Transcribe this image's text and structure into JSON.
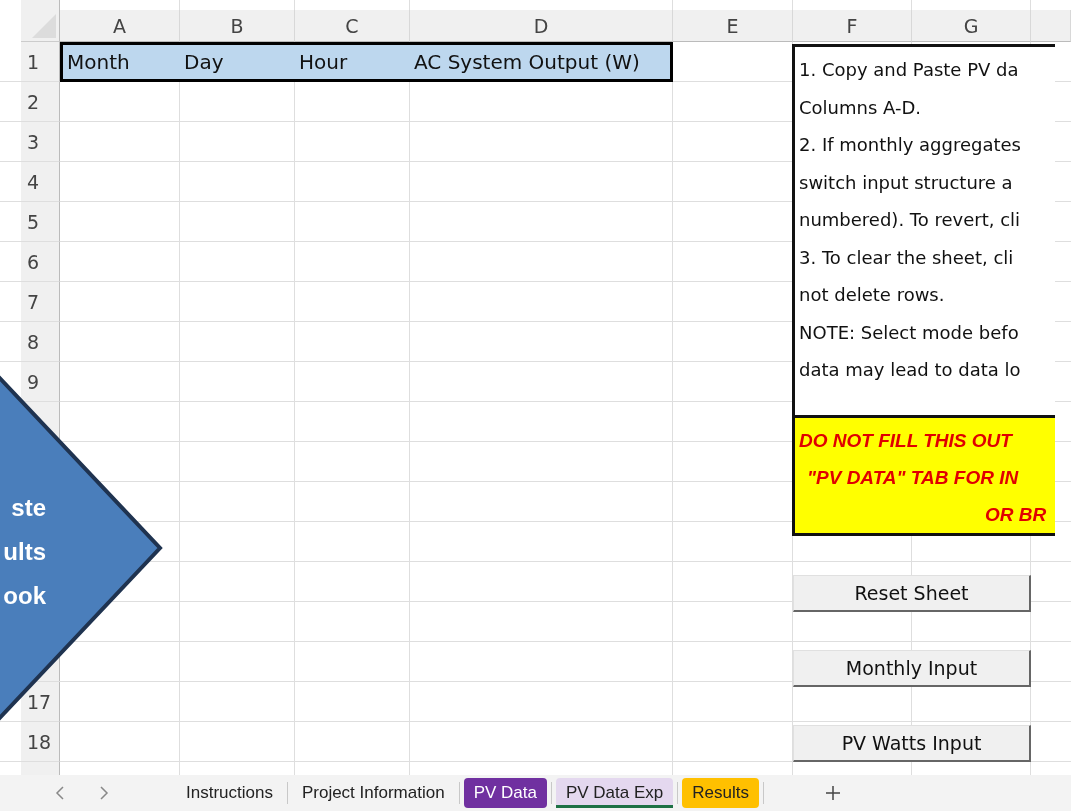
{
  "columns": [
    "A",
    "B",
    "C",
    "D",
    "E",
    "F",
    "G"
  ],
  "row_numbers": [
    "1",
    "2",
    "3",
    "4",
    "5",
    "6",
    "7",
    "8",
    "9",
    "17",
    "18"
  ],
  "header_row": [
    "Month",
    "Day",
    "Hour",
    "AC System Output (W)"
  ],
  "instructions": {
    "lines": [
      "1. Copy and Paste PV da",
      "Columns A-D.",
      "2. If monthly aggregates",
      "switch input structure a",
      "numbered). To revert, cli",
      "3. To clear the sheet, cli",
      "not delete rows.",
      "NOTE: Select mode befo",
      "data may lead to data lo"
    ],
    "warning_lines": [
      "DO NOT FILL THIS OUT",
      "\"PV DATA\" TAB FOR IN",
      "OR BR"
    ]
  },
  "buttons": [
    "Reset Sheet",
    "Monthly Input",
    "PV Watts Input"
  ],
  "callout": {
    "lines": [
      "ste",
      "ults",
      "ook"
    ]
  },
  "sheet_tabs": [
    {
      "label": "Instructions",
      "selected": false
    },
    {
      "label": "Project Information",
      "selected": false
    },
    {
      "label": "PV Data",
      "selected": false,
      "color": "#7030a0"
    },
    {
      "label": "PV Data Exp",
      "selected": true
    },
    {
      "label": "Results",
      "selected": false,
      "color": "#ffc000"
    }
  ]
}
